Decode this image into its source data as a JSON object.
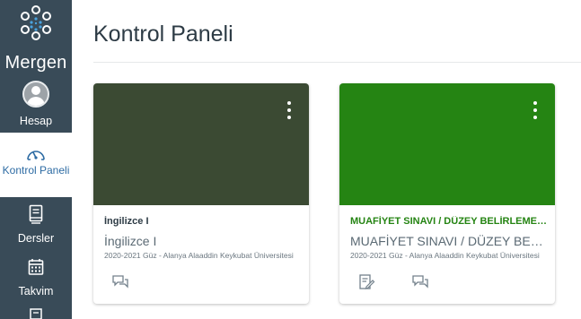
{
  "nav": {
    "logo_label": "Mergen",
    "items": [
      {
        "label": "Hesap",
        "icon": "avatar-icon"
      },
      {
        "label": "Kontrol Paneli",
        "icon": "dashboard-icon",
        "active": true
      },
      {
        "label": "Dersler",
        "icon": "courses-icon"
      },
      {
        "label": "Takvim",
        "icon": "calendar-icon"
      },
      {
        "label": "",
        "icon": "inbox-icon"
      }
    ],
    "colors": {
      "background": "#394b58",
      "active_background": "#ffffff",
      "active_text": "#2d6ba3"
    }
  },
  "main": {
    "title": "Kontrol Paneli",
    "cards": [
      {
        "name": "İngilizce I",
        "code": "İngilizce I",
        "term": "2020-2021 Güz - Alanya Alaaddin Keykubat Üniversitesi",
        "color": "#3b4a33",
        "name_color": "#2d3b45",
        "actions": [
          "discussions-icon"
        ]
      },
      {
        "name": "MUAFİYET SINAVI / DÜZEY BELİRLEME SINAVI",
        "code": "MUAFİYET SINAVI / DÜZEY BELİRLEME SINAVI",
        "term": "2020-2021 Güz - Alanya Alaaddin Keykubat Üniversitesi",
        "color": "#258413",
        "name_color": "#258413",
        "actions": [
          "assignments-icon",
          "discussions-icon"
        ]
      }
    ]
  }
}
